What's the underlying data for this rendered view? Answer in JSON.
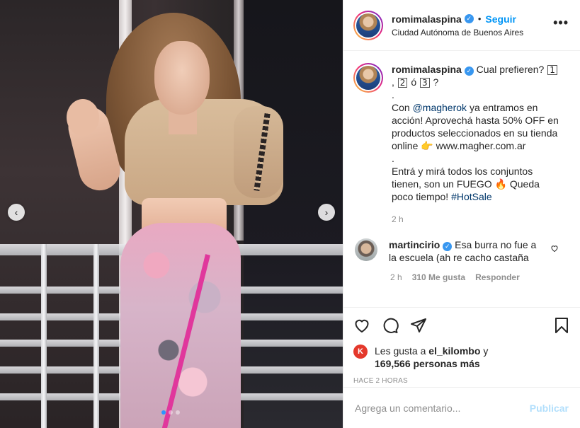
{
  "header": {
    "username": "romimalaspina",
    "separator": "•",
    "follow_label": "Seguir",
    "location": "Ciudad Autónoma de Buenos Aires",
    "more_label": "•••"
  },
  "caption": {
    "username": "romimalaspina",
    "text_1": "Cual prefieren?",
    "opt1": "1",
    "text_sep": ",",
    "opt2": "2",
    "text_o": "ó",
    "opt3": "3",
    "text_q": "?",
    "dot1": ".",
    "line_con": "Con",
    "mention": "@magherok",
    "line_2": "ya entramos en acción! Aprovechá hasta 50% OFF en productos seleccionados en su tienda online",
    "pointer_emoji": "👉",
    "site": "www.magher.com.ar",
    "dot2": ".",
    "line_3": "Entrá y mirá todos los conjuntos tienen, son un FUEGO",
    "fire_emoji": "🔥",
    "line_4": "Queda poco tiempo!",
    "hashtag": "#HotSale",
    "time": "2 h"
  },
  "comment": {
    "username": "martincirio",
    "text": "Esa burra no fue a la escuela (ah re cacho castaña",
    "time": "2 h",
    "likes": "310 Me gusta",
    "reply_label": "Responder",
    "heart_icon": "heart-outline"
  },
  "likes": {
    "avatar_letter": "K",
    "prefix": "Les gusta a",
    "user": "el_kilombo",
    "and": "y",
    "count": "169,566 personas más"
  },
  "time_ago": "HACE 2 HORAS",
  "add_comment": {
    "placeholder": "Agrega un comentario...",
    "publish_label": "Publicar"
  },
  "media": {
    "prev_label": "‹",
    "next_label": "›",
    "carousel_count": 3,
    "active_index": 0
  },
  "colors": {
    "accent": "#0095f6",
    "verified": "#3897f0",
    "publish_disabled": "#b2dffc",
    "meta_gray": "#8e8e8e"
  }
}
